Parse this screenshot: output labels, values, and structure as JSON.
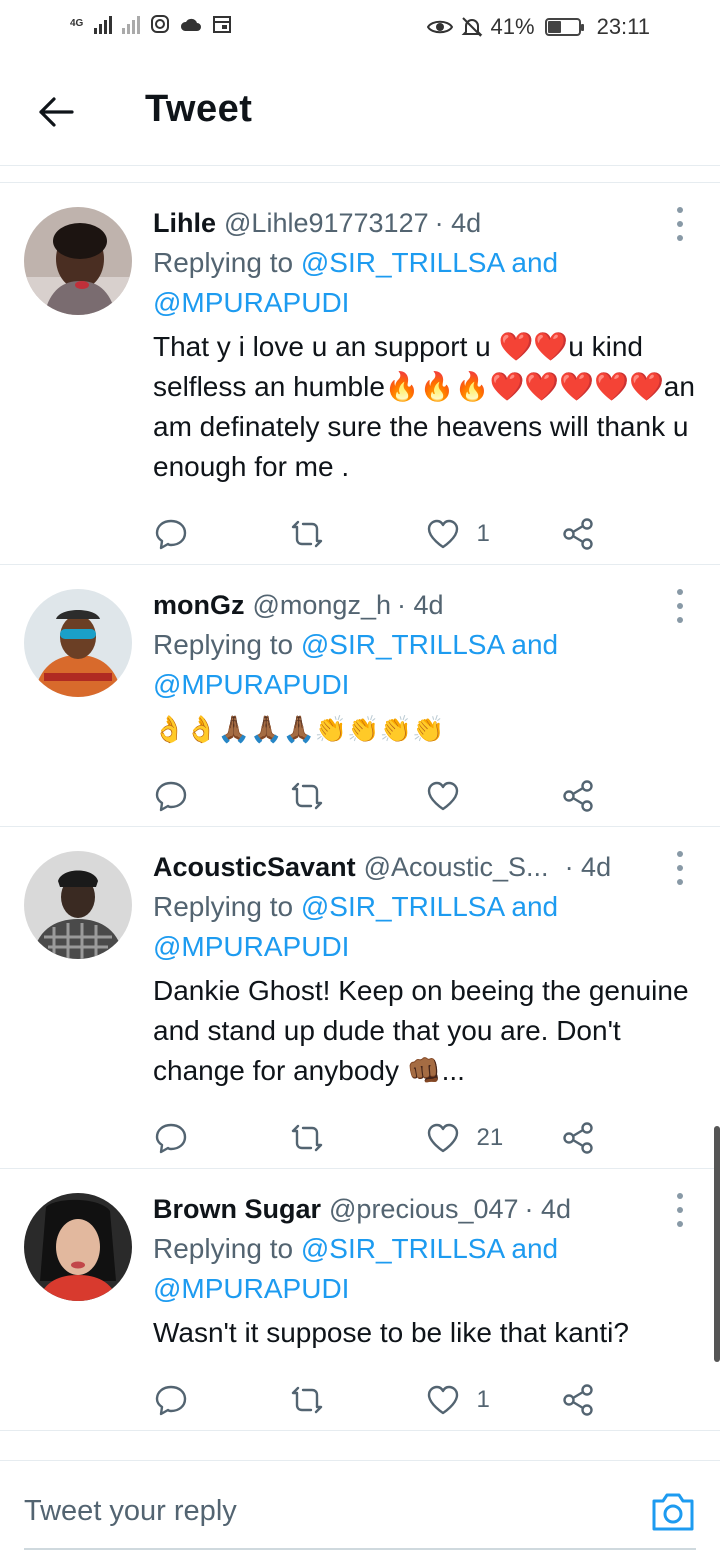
{
  "status_bar": {
    "network": "4G",
    "battery": "41%",
    "time": "23:11"
  },
  "header": {
    "title": "Tweet"
  },
  "replying_prefix": "Replying to",
  "replying_and": "and",
  "tweets": [
    {
      "name": "Lihle",
      "handle": "@Lihle91773127",
      "time": "· 4d",
      "mentions": [
        "@SIR_TRILLSA",
        "@MPURAPUDI"
      ],
      "text": "That y i love u an support u ❤️❤️u kind selfless an humble🔥🔥🔥❤️❤️❤️❤️❤️an am definately sure the heavens will thank u enough for me .",
      "likes": "1"
    },
    {
      "name": "monGz",
      "handle": "@mongz_h",
      "time": "· 4d",
      "mentions": [
        "@SIR_TRILLSA",
        "@MPURAPUDI"
      ],
      "text": "👌👌🙏🏾🙏🏾🙏🏾👏👏👏👏",
      "likes": ""
    },
    {
      "name": "AcousticSavant",
      "handle": "@Acoustic_S...",
      "time": "· 4d",
      "mentions": [
        "@SIR_TRILLSA",
        "@MPURAPUDI"
      ],
      "text": "Dankie Ghost! Keep on beeing the genuine and stand up dude that you are. Don't change for anybody 👊🏾...",
      "likes": "21"
    },
    {
      "name": "Brown Sugar",
      "handle": "@precious_047",
      "time": "· 4d",
      "mentions": [
        "@SIR_TRILLSA",
        "@MPURAPUDI"
      ],
      "text": "Wasn't it suppose to be like that kanti?",
      "likes": "1"
    }
  ],
  "reply_bar": {
    "placeholder": "Tweet your reply"
  },
  "icons": {
    "back": "arrow-left-icon",
    "reply": "comment-icon",
    "retweet": "retweet-icon",
    "like": "heart-icon",
    "share": "share-icon",
    "more": "more-vertical-icon",
    "camera": "camera-icon"
  },
  "colors": {
    "accent": "#1d9bf0",
    "text": "#0f1419",
    "secondary": "#536471",
    "divider": "#e6ecf0"
  }
}
